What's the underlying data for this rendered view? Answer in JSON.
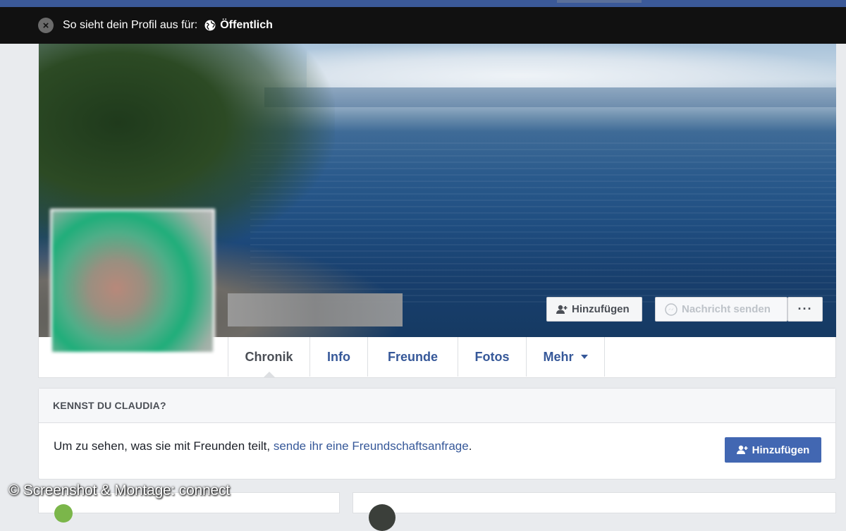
{
  "view_bar": {
    "prefix": "So sieht dein Profil aus für:",
    "audience": "Öffentlich"
  },
  "cover_actions": {
    "add_friend": "Hinzufügen",
    "send_message": "Nachricht senden",
    "more": "···"
  },
  "tabs": [
    {
      "label": "Chronik",
      "active": true
    },
    {
      "label": "Info"
    },
    {
      "label": "Freunde"
    },
    {
      "label": "Fotos"
    },
    {
      "label": "Mehr"
    }
  ],
  "know_card": {
    "heading": "KENNST DU CLAUDIA?",
    "text": "Um zu sehen, was sie mit Freunden teilt,",
    "link": "sende ihr eine Freundschaftsanfrage",
    "after_link": ".",
    "button": "Hinzufügen"
  },
  "watermark": "© Screenshot & Montage: connect",
  "colors": {
    "facebook_blue": "#4267b2",
    "link_blue": "#365899",
    "view_bar_bg": "#111111"
  }
}
